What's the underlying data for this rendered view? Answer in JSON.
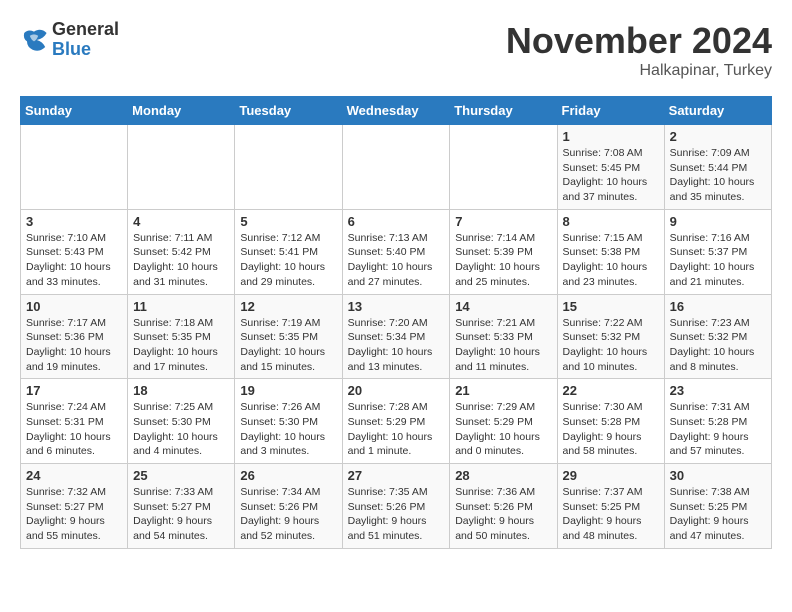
{
  "logo": {
    "general": "General",
    "blue": "Blue"
  },
  "title": "November 2024",
  "subtitle": "Halkapinar, Turkey",
  "days_of_week": [
    "Sunday",
    "Monday",
    "Tuesday",
    "Wednesday",
    "Thursday",
    "Friday",
    "Saturday"
  ],
  "weeks": [
    [
      {
        "day": "",
        "info": ""
      },
      {
        "day": "",
        "info": ""
      },
      {
        "day": "",
        "info": ""
      },
      {
        "day": "",
        "info": ""
      },
      {
        "day": "",
        "info": ""
      },
      {
        "day": "1",
        "info": "Sunrise: 7:08 AM\nSunset: 5:45 PM\nDaylight: 10 hours and 37 minutes."
      },
      {
        "day": "2",
        "info": "Sunrise: 7:09 AM\nSunset: 5:44 PM\nDaylight: 10 hours and 35 minutes."
      }
    ],
    [
      {
        "day": "3",
        "info": "Sunrise: 7:10 AM\nSunset: 5:43 PM\nDaylight: 10 hours and 33 minutes."
      },
      {
        "day": "4",
        "info": "Sunrise: 7:11 AM\nSunset: 5:42 PM\nDaylight: 10 hours and 31 minutes."
      },
      {
        "day": "5",
        "info": "Sunrise: 7:12 AM\nSunset: 5:41 PM\nDaylight: 10 hours and 29 minutes."
      },
      {
        "day": "6",
        "info": "Sunrise: 7:13 AM\nSunset: 5:40 PM\nDaylight: 10 hours and 27 minutes."
      },
      {
        "day": "7",
        "info": "Sunrise: 7:14 AM\nSunset: 5:39 PM\nDaylight: 10 hours and 25 minutes."
      },
      {
        "day": "8",
        "info": "Sunrise: 7:15 AM\nSunset: 5:38 PM\nDaylight: 10 hours and 23 minutes."
      },
      {
        "day": "9",
        "info": "Sunrise: 7:16 AM\nSunset: 5:37 PM\nDaylight: 10 hours and 21 minutes."
      }
    ],
    [
      {
        "day": "10",
        "info": "Sunrise: 7:17 AM\nSunset: 5:36 PM\nDaylight: 10 hours and 19 minutes."
      },
      {
        "day": "11",
        "info": "Sunrise: 7:18 AM\nSunset: 5:35 PM\nDaylight: 10 hours and 17 minutes."
      },
      {
        "day": "12",
        "info": "Sunrise: 7:19 AM\nSunset: 5:35 PM\nDaylight: 10 hours and 15 minutes."
      },
      {
        "day": "13",
        "info": "Sunrise: 7:20 AM\nSunset: 5:34 PM\nDaylight: 10 hours and 13 minutes."
      },
      {
        "day": "14",
        "info": "Sunrise: 7:21 AM\nSunset: 5:33 PM\nDaylight: 10 hours and 11 minutes."
      },
      {
        "day": "15",
        "info": "Sunrise: 7:22 AM\nSunset: 5:32 PM\nDaylight: 10 hours and 10 minutes."
      },
      {
        "day": "16",
        "info": "Sunrise: 7:23 AM\nSunset: 5:32 PM\nDaylight: 10 hours and 8 minutes."
      }
    ],
    [
      {
        "day": "17",
        "info": "Sunrise: 7:24 AM\nSunset: 5:31 PM\nDaylight: 10 hours and 6 minutes."
      },
      {
        "day": "18",
        "info": "Sunrise: 7:25 AM\nSunset: 5:30 PM\nDaylight: 10 hours and 4 minutes."
      },
      {
        "day": "19",
        "info": "Sunrise: 7:26 AM\nSunset: 5:30 PM\nDaylight: 10 hours and 3 minutes."
      },
      {
        "day": "20",
        "info": "Sunrise: 7:28 AM\nSunset: 5:29 PM\nDaylight: 10 hours and 1 minute."
      },
      {
        "day": "21",
        "info": "Sunrise: 7:29 AM\nSunset: 5:29 PM\nDaylight: 10 hours and 0 minutes."
      },
      {
        "day": "22",
        "info": "Sunrise: 7:30 AM\nSunset: 5:28 PM\nDaylight: 9 hours and 58 minutes."
      },
      {
        "day": "23",
        "info": "Sunrise: 7:31 AM\nSunset: 5:28 PM\nDaylight: 9 hours and 57 minutes."
      }
    ],
    [
      {
        "day": "24",
        "info": "Sunrise: 7:32 AM\nSunset: 5:27 PM\nDaylight: 9 hours and 55 minutes."
      },
      {
        "day": "25",
        "info": "Sunrise: 7:33 AM\nSunset: 5:27 PM\nDaylight: 9 hours and 54 minutes."
      },
      {
        "day": "26",
        "info": "Sunrise: 7:34 AM\nSunset: 5:26 PM\nDaylight: 9 hours and 52 minutes."
      },
      {
        "day": "27",
        "info": "Sunrise: 7:35 AM\nSunset: 5:26 PM\nDaylight: 9 hours and 51 minutes."
      },
      {
        "day": "28",
        "info": "Sunrise: 7:36 AM\nSunset: 5:26 PM\nDaylight: 9 hours and 50 minutes."
      },
      {
        "day": "29",
        "info": "Sunrise: 7:37 AM\nSunset: 5:25 PM\nDaylight: 9 hours and 48 minutes."
      },
      {
        "day": "30",
        "info": "Sunrise: 7:38 AM\nSunset: 5:25 PM\nDaylight: 9 hours and 47 minutes."
      }
    ]
  ]
}
